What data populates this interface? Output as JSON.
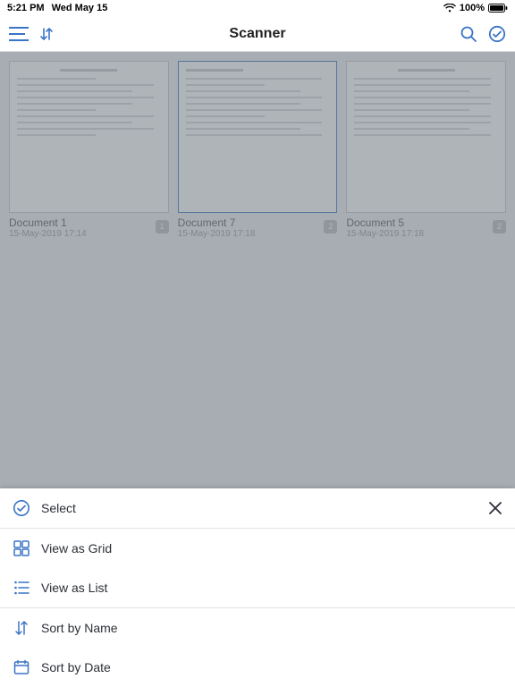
{
  "status": {
    "time": "5:21 PM",
    "date": "Wed May 15",
    "battery": "100%"
  },
  "nav": {
    "title": "Scanner"
  },
  "docs": [
    {
      "title": "Document 1",
      "date": "15-May-2019 17:14",
      "count": "1"
    },
    {
      "title": "Document 7",
      "date": "15-May-2019 17:18",
      "count": "2"
    },
    {
      "title": "Document 5",
      "date": "15-May-2019 17:18",
      "count": "2"
    }
  ],
  "sheet": {
    "select": "Select",
    "grid": "View as Grid",
    "list": "View as List",
    "sortName": "Sort by Name",
    "sortDate": "Sort by Date"
  }
}
